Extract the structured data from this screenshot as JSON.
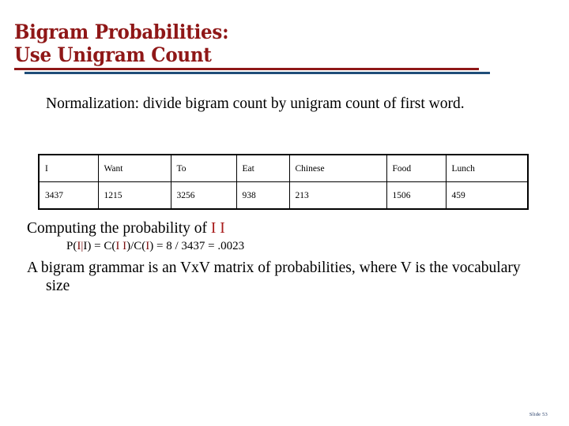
{
  "slide": {
    "title_line_1": "Bigram Probabilities:",
    "title_line_2": "Use Unigram Count",
    "title_color": "#8F1717",
    "rule_red_color": "#8F1717",
    "rule_blue_color": "#1F4E79",
    "footer": "Slide 53",
    "footer_color": "#203864",
    "background": "#ffffff"
  },
  "body": {
    "normalization_text": "Normalization:  divide bigram count by unigram count of first word.",
    "computing_prefix": "Computing the probability of ",
    "computing_token_1": "I",
    "computing_token_space": " ",
    "computing_token_2": "I",
    "matrix_text": "A bigram grammar is an VxV matrix of probabilities, where V is the vocabulary size"
  },
  "formula": {
    "p_open": "P(",
    "p_arg_1": "I",
    "p_bar": "|",
    "p_arg_2": "I",
    "p_close": ")",
    "eq_1": " = C(",
    "c_arg_1": "I",
    "c_space": " ",
    "c_arg_2": "I",
    "c_close": ")/C(",
    "c_arg_3": "I",
    "c_close_2": ")",
    "eq_2": " = 8 / 3437 = .0023"
  },
  "table": {
    "headers": [
      "I",
      "Want",
      "To",
      "Eat",
      "Chinese",
      "Food",
      "Lunch"
    ],
    "counts": [
      "3437",
      "1215",
      "3256",
      "938",
      "213",
      "1506",
      "459"
    ]
  }
}
